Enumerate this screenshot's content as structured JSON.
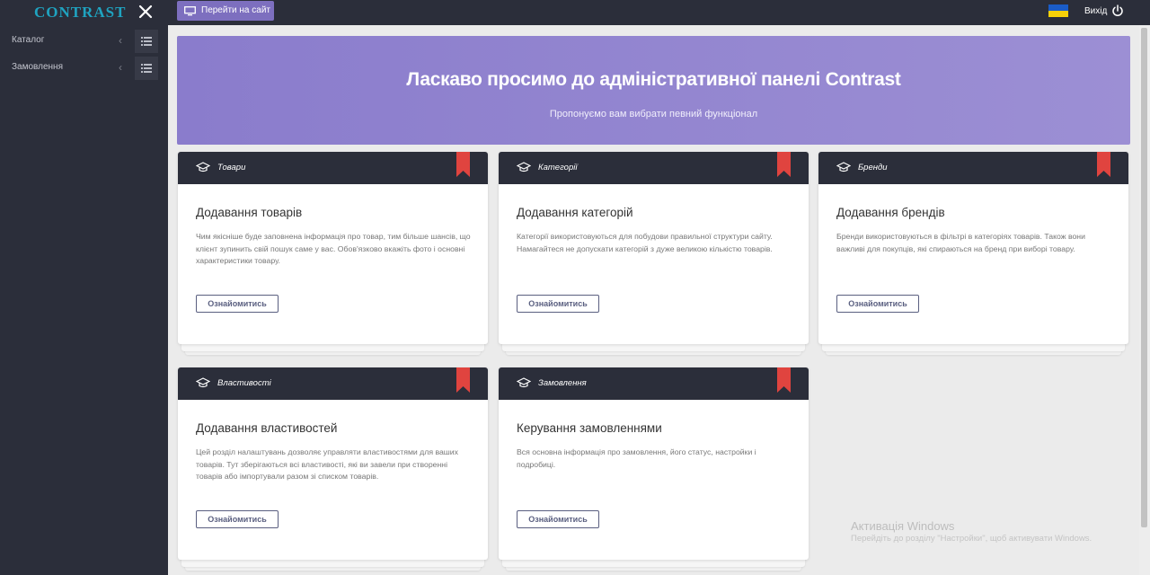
{
  "sidebar": {
    "logo": "CONTRAST",
    "items": [
      {
        "label": "Каталог"
      },
      {
        "label": "Замовлення"
      }
    ],
    "chevron": "‹"
  },
  "topbar": {
    "site_button": "Перейти на сайт",
    "logout": "Вихід"
  },
  "hero": {
    "title": "Ласкаво просимо до адміністративної панелі Contrast",
    "subtitle": "Пропонуємо вам вибрати певний функціонал"
  },
  "cards": [
    {
      "category": "Товари",
      "title": "Додавання товарів",
      "description": "Чим якісніше буде заповнена інформація про товар, тим більше шансів, що клієнт зупинить свій пошук саме у вас. Обов'язково вкажіть фото і основні характеристики товару.",
      "button": "Ознайомитись"
    },
    {
      "category": "Категорії",
      "title": "Додавання категорій",
      "description": "Категорії використовуються для побудови правильної структури сайту. Намагайтеся не допускати категорій з дуже великою кількістю товарів.",
      "button": "Ознайомитись"
    },
    {
      "category": "Бренди",
      "title": "Додавання брендів",
      "description": "Бренди використовуються в фільтрі в категоріях товарів. Також вони важливі для покупців, які спираються на бренд при виборі товару.",
      "button": "Ознайомитись"
    },
    {
      "category": "Властивості",
      "title": "Додавання властивостей",
      "description": "Цей розділ налаштувань дозволяє управляти властивостями для ваших товарів. Тут зберігаються всі властивості, які ви завели при створенні товарів або імпортували разом зі списком товарів.",
      "button": "Ознайомитись"
    },
    {
      "category": "Замовлення",
      "title": "Керування замовленнями",
      "description": "Вся основна інформація про замовлення, його статус, настройки і подробиці.",
      "button": "Ознайомитись"
    }
  ],
  "watermark": {
    "title": "Активація Windows",
    "subtitle": "Перейдіть до розділу \"Настройки\", щоб активувати Windows."
  },
  "icons": {
    "close": "close-icon",
    "list": "list-icon",
    "monitor": "monitor-icon",
    "flag": "ukraine-flag-icon",
    "power": "power-icon",
    "hat": "graduation-cap-icon",
    "ribbon": "bookmark-ribbon-icon"
  },
  "colors": {
    "sidebar_bg": "#2b2e3a",
    "accent": "#7d6fbf",
    "logo": "#1fa3c0",
    "ribbon": "#e0443f"
  }
}
